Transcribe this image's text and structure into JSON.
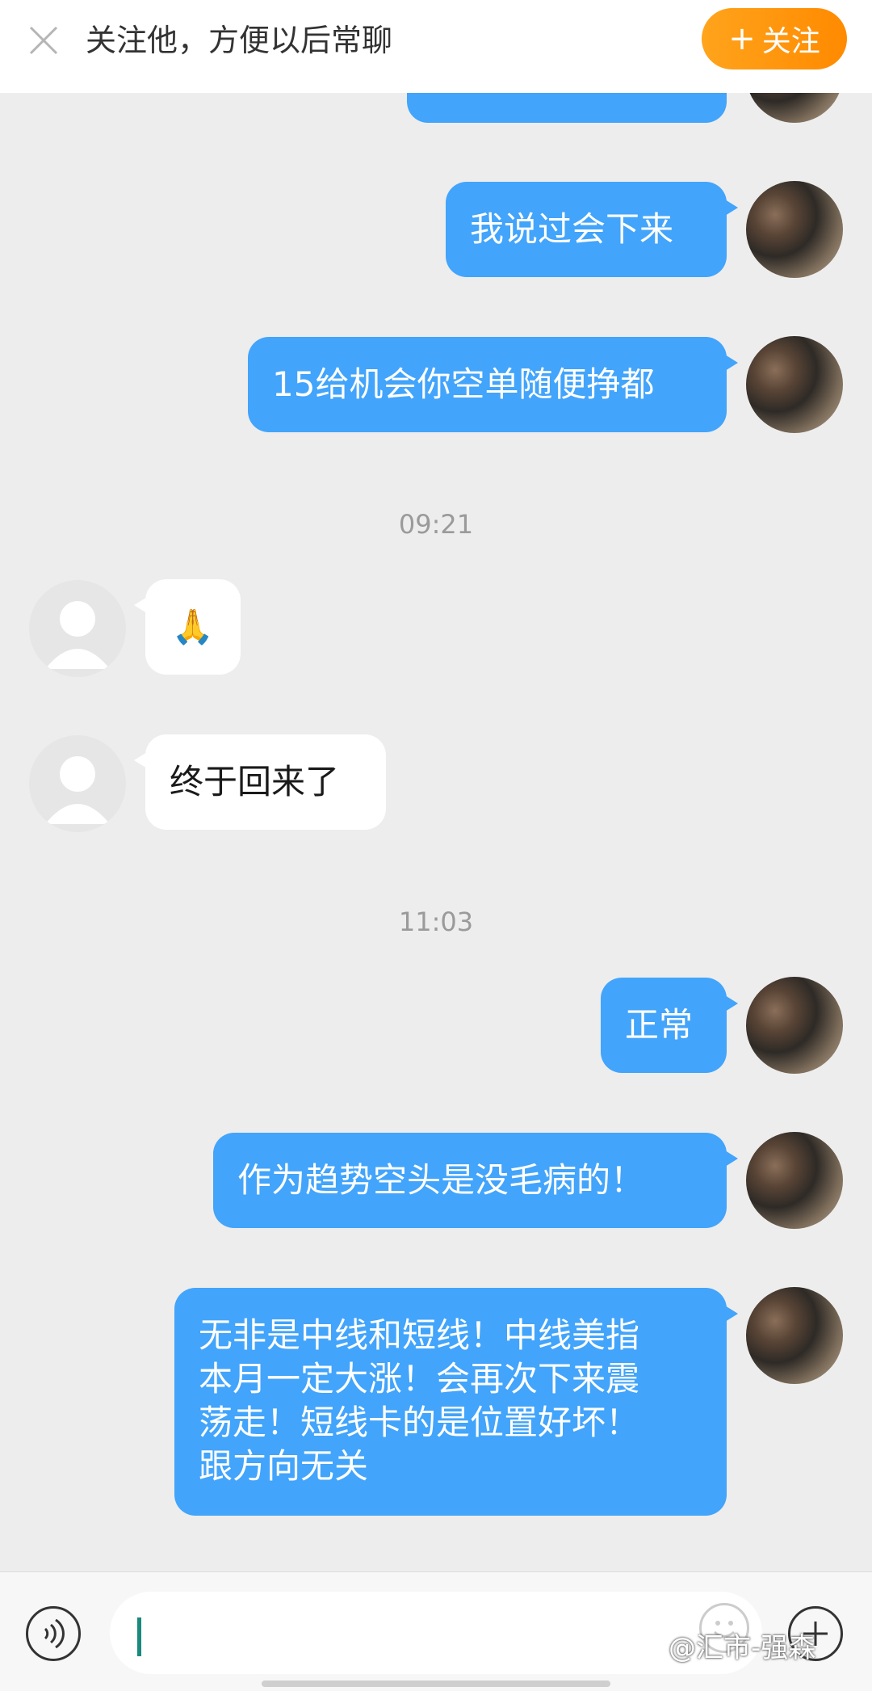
{
  "header": {
    "prompt_text": "关注他，方便以后常聊",
    "follow_plus": "+",
    "follow_label": "关注"
  },
  "messages": {
    "m1": "我说过会下来",
    "m2": "15给机会你空单随便挣都",
    "ts1": "09:21",
    "m3": "🙏",
    "m4": "终于回来了",
    "ts2": "11:03",
    "m5": "正常",
    "m6": "作为趋势空头是没毛病的！",
    "m7_line1": "无非是中线和短线！中线美指",
    "m7_line2": "本月一定大涨！会再次下来震",
    "m7_line3": "荡走！短线卡的是位置好坏！",
    "m7_line4": "跟方向无关"
  },
  "watermark": "@汇市-强森",
  "colors": {
    "outgoing_bubble": "#42a4fb",
    "incoming_bubble": "#ffffff",
    "follow_button": "#ff9a10",
    "background": "#ededed"
  },
  "icons": {
    "close": "close-icon",
    "voice": "voice-icon",
    "emoji": "emoji-icon",
    "plus": "plus-icon"
  }
}
